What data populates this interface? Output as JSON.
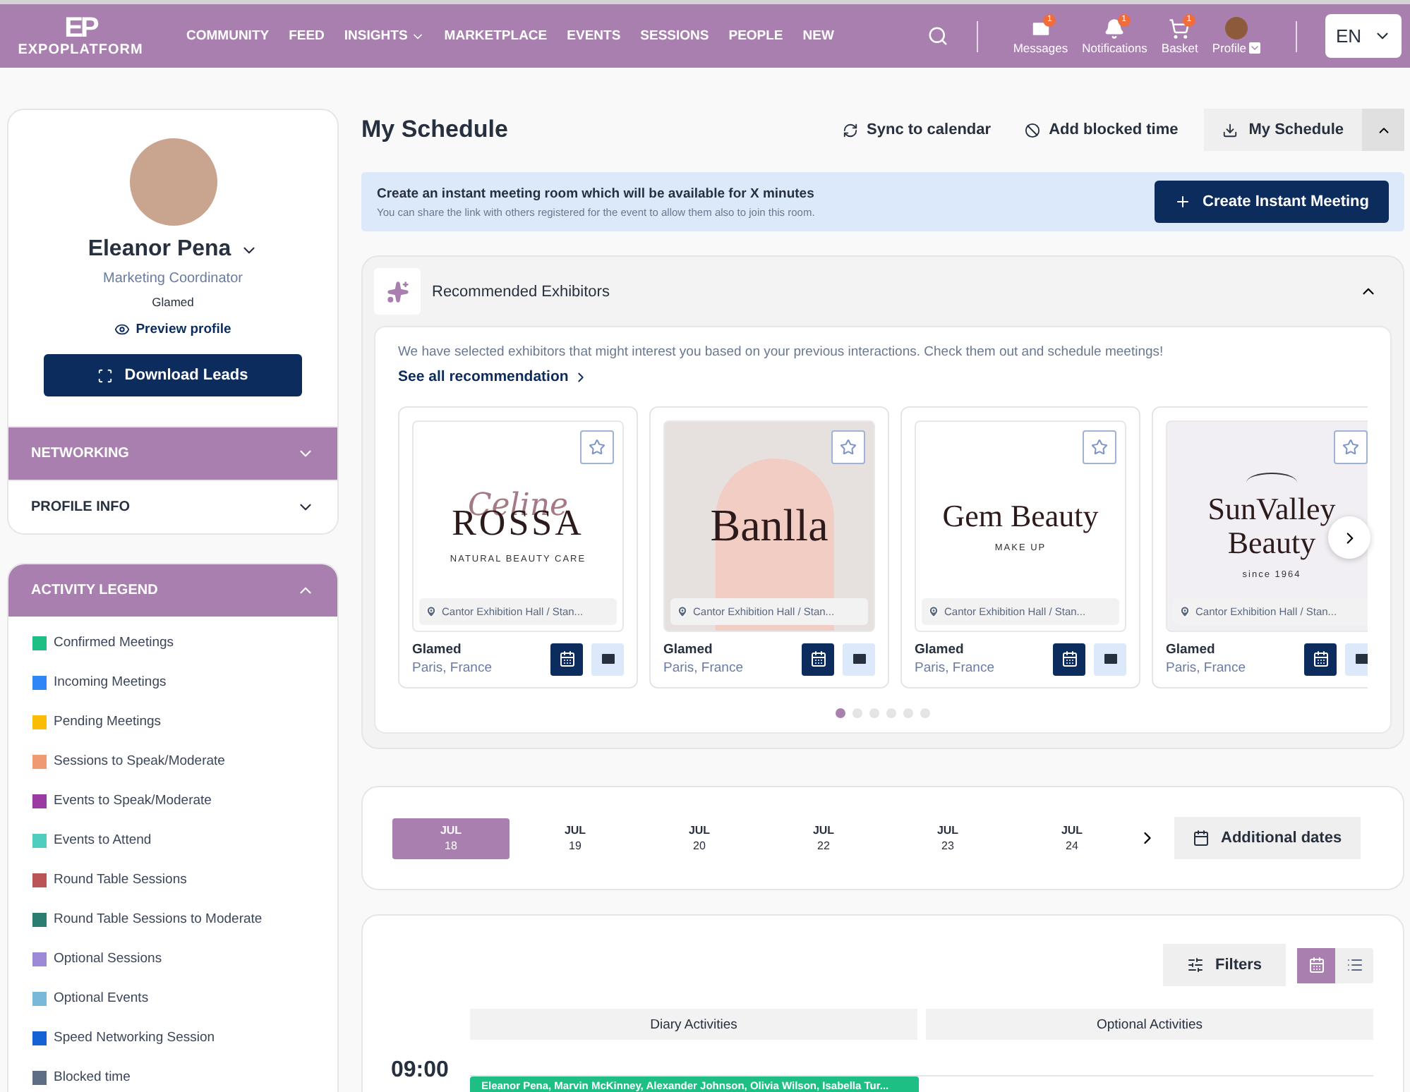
{
  "header": {
    "logo_mark": "EP",
    "logo_text": "EXPOPLATFORM",
    "nav": [
      {
        "label": "COMMUNITY",
        "dropdown": false
      },
      {
        "label": "FEED",
        "dropdown": false
      },
      {
        "label": "INSIGHTS",
        "dropdown": true
      },
      {
        "label": "MARKETPLACE",
        "dropdown": false
      },
      {
        "label": "EVENTS",
        "dropdown": false
      },
      {
        "label": "SESSIONS",
        "dropdown": false
      },
      {
        "label": "PEOPLE",
        "dropdown": false
      },
      {
        "label": "NEW",
        "dropdown": false
      }
    ],
    "actions": [
      {
        "kind": "messages",
        "label": "Messages",
        "badge": "1"
      },
      {
        "kind": "notifications",
        "label": "Notifications",
        "badge": "1"
      },
      {
        "kind": "basket",
        "label": "Basket",
        "badge": "1"
      },
      {
        "kind": "profile",
        "label": "Profile"
      }
    ],
    "language": "EN"
  },
  "profile": {
    "name": "Eleanor Pena",
    "role": "Marketing Coordinator",
    "company": "Glamed",
    "preview": "Preview profile",
    "download": "Download Leads",
    "sections": [
      {
        "label": "NETWORKING",
        "selected": true
      },
      {
        "label": "PROFILE INFO",
        "selected": false
      }
    ]
  },
  "legend": {
    "title": "ACTIVITY LEGEND",
    "expanded": true,
    "items": [
      {
        "label": "Confirmed Meetings",
        "color": "#1dbf84"
      },
      {
        "label": "Incoming Meetings",
        "color": "#2f86f6"
      },
      {
        "label": "Pending Meetings",
        "color": "#fbbc05"
      },
      {
        "label": "Sessions to Speak/Moderate",
        "color": "#ef9a72"
      },
      {
        "label": "Events to Speak/Moderate",
        "color": "#9a3ba3"
      },
      {
        "label": "Events to Attend",
        "color": "#4fcdbd"
      },
      {
        "label": "Round Table Sessions",
        "color": "#b95555"
      },
      {
        "label": "Round Table Sessions to Moderate",
        "color": "#2a7d70"
      },
      {
        "label": "Optional Sessions",
        "color": "#9c8ad8"
      },
      {
        "label": "Optional Events",
        "color": "#7ab8da"
      },
      {
        "label": "Speed Networking Session",
        "color": "#1561d6"
      },
      {
        "label": "Blocked time",
        "color": "#5e6e85"
      }
    ]
  },
  "schedule": {
    "title": "My Schedule",
    "actions": [
      {
        "kind": "sync",
        "label": "Sync to calendar"
      },
      {
        "kind": "block",
        "label": "Add blocked time"
      }
    ],
    "download": "My Schedule"
  },
  "banner": {
    "title": "Create an instant meeting room which will be available for X minutes",
    "text": "You can share the link with others registered for the event to allow them also to join this room.",
    "button": "Create Instant Meeting"
  },
  "recommended": {
    "title": "Recommended Exhibitors",
    "expanded": true,
    "intro": "We have selected exhibitors that might interest you based on your previous interactions. Check them out and schedule meetings!",
    "link": "See all recommendation",
    "exhibitors": [
      {
        "logo": {
          "kind": "script",
          "script": "Celine",
          "title": "ROSSA",
          "subtitle": "NATURAL BEAUTY CARE"
        },
        "location": "Cantor Exhibition Hall / Stan...",
        "name": "Glamed",
        "place": "Paris, France"
      },
      {
        "logo": {
          "kind": "arch",
          "title": "Banlla"
        },
        "location": "Cantor Exhibition Hall / Stan...",
        "name": "Glamed",
        "place": "Paris, France"
      },
      {
        "logo": {
          "kind": "plain",
          "title": "Gem Beauty",
          "subtitle": "MAKE UP"
        },
        "location": "Cantor Exhibition Hall / Stan...",
        "name": "Glamed",
        "place": "Paris, France"
      },
      {
        "logo": {
          "kind": "arc",
          "title": "SunValley Beauty",
          "subtitle": "since 1964"
        },
        "location": "Cantor Exhibition Hall / Stan...",
        "name": "Glamed",
        "place": "Paris, France"
      }
    ],
    "dots": [
      {
        "selected": true
      },
      {
        "selected": false
      },
      {
        "selected": false
      },
      {
        "selected": false
      },
      {
        "selected": false
      },
      {
        "selected": false
      }
    ]
  },
  "dates": {
    "days": [
      {
        "month": "JUL",
        "day": "18",
        "selected": true
      },
      {
        "month": "JUL",
        "day": "19",
        "selected": false
      },
      {
        "month": "JUL",
        "day": "20",
        "selected": false
      },
      {
        "month": "JUL",
        "day": "22",
        "selected": false
      },
      {
        "month": "JUL",
        "day": "23",
        "selected": false
      },
      {
        "month": "JUL",
        "day": "24",
        "selected": false
      }
    ],
    "more": "Additional dates"
  },
  "diary": {
    "filters": "Filters",
    "views": [
      {
        "kind": "calendar",
        "selected": true
      },
      {
        "kind": "list",
        "selected": false
      }
    ],
    "columns": [
      "Diary Activities",
      "Optional Activities"
    ],
    "rows": [
      {
        "time": "09:00",
        "event": {
          "label": "Eleanor Pena, Marvin McKinney, Alexander Johnson, Olivia Wilson, Isabella Tur...",
          "color": "#1dbf84"
        }
      }
    ]
  }
}
